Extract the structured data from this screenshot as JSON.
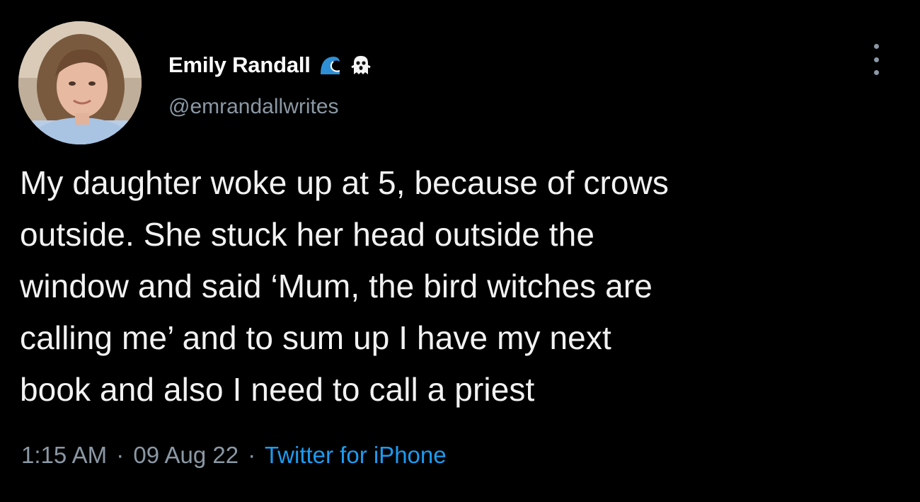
{
  "author": {
    "display_name": "Emily Randall",
    "handle": "@emrandallwrites",
    "name_emojis": [
      "wave-icon",
      "ghost-icon"
    ]
  },
  "tweet": {
    "lines": [
      "My daughter woke up at 5, because of crows",
      "outside. She stuck her head outside the",
      "window and said ‘Mum, the bird witches are",
      "calling me’ and to sum up I have my next",
      "book and also I need to call a priest"
    ]
  },
  "meta": {
    "time": "1:15 AM",
    "separator": "·",
    "date": "09 Aug 22",
    "source": "Twitter for iPhone"
  },
  "colors": {
    "background": "#000000",
    "text": "#e7e9ea",
    "secondary": "#8b98a5",
    "link": "#1d9bf0"
  }
}
